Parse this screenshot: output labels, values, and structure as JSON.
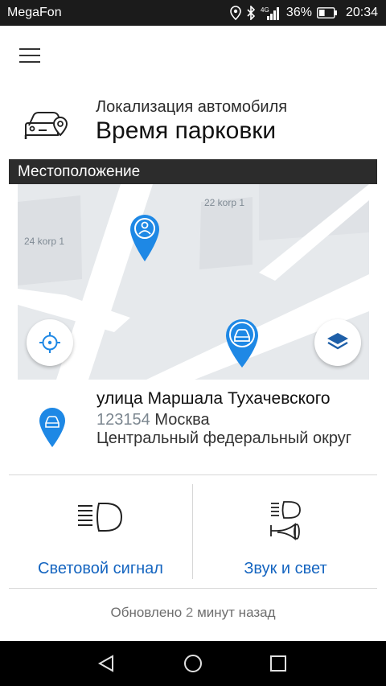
{
  "status_bar": {
    "carrier": "MegaFon",
    "network": "4G",
    "battery": "36%",
    "time": "20:34",
    "icons": [
      "location-icon",
      "bluetooth-icon",
      "signal-icon",
      "battery-icon"
    ]
  },
  "header": {
    "subtitle": "Локализация автомобиля",
    "title": "Время парковки",
    "icon": "car-location-icon"
  },
  "section": {
    "title": "Местоположение"
  },
  "map": {
    "labels": [
      "22 korp 1",
      "24 korp 1"
    ],
    "user_pin": "user-pin-icon",
    "car_pin": "car-pin-icon",
    "locate_button": "crosshair-icon",
    "layers_button": "layers-icon",
    "pin_color": "#1e88e5"
  },
  "address": {
    "street": "улица Маршала Тухачевского",
    "postcode": "123154",
    "city": "Москва",
    "region": "Центральный федеральный округ"
  },
  "actions": [
    {
      "label": "Световой сигнал",
      "icon": "headlight-icon"
    },
    {
      "label": "Звук и свет",
      "icon": "horn-light-icon"
    }
  ],
  "updated": {
    "prefix": "Обновлено",
    "number": "2",
    "suffix": "минут назад"
  },
  "accent_color": "#1565c0"
}
